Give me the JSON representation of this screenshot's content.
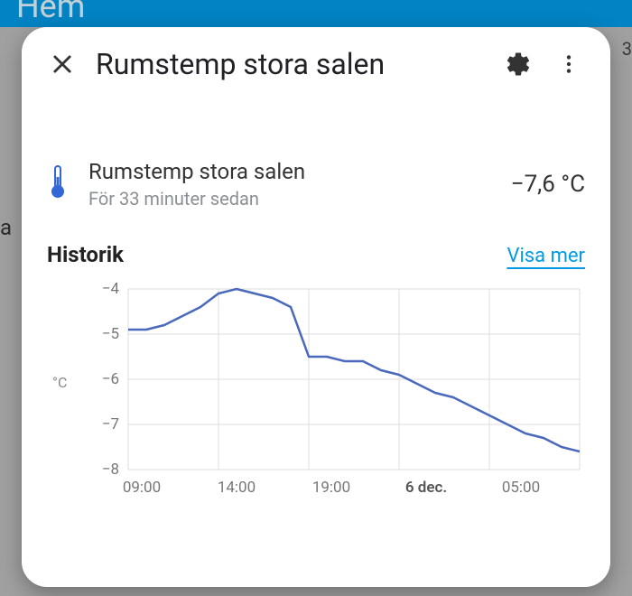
{
  "background": {
    "app_title": "Hem",
    "right_digit": "3",
    "left_fragment": "a"
  },
  "dialog": {
    "title": "Rumstemp stora salen"
  },
  "sensor": {
    "name": "Rumstemp stora salen",
    "updated": "För 33 minuter sedan",
    "value": "−7,6 °C"
  },
  "history": {
    "title": "Historik",
    "show_more": "Visa mer"
  },
  "chart_data": {
    "type": "line",
    "title": "",
    "xlabel": "",
    "ylabel": "°C",
    "ylim": [
      -8,
      -4
    ],
    "y_ticks": [
      -4,
      -5,
      -6,
      -7,
      -8
    ],
    "x_ticks": [
      "09:00",
      "14:00",
      "19:00",
      "6 dec.",
      "05:00"
    ],
    "x_tick_bold_index": 3,
    "x": [
      "08:00",
      "09:00",
      "10:00",
      "11:00",
      "12:00",
      "13:00",
      "14:00",
      "15:00",
      "16:00",
      "17:00",
      "17:30",
      "18:00",
      "19:00",
      "20:00",
      "21:00",
      "22:00",
      "23:00",
      "00:00",
      "01:00",
      "02:00",
      "03:00",
      "04:00",
      "05:00",
      "06:00",
      "07:00",
      "08:00"
    ],
    "values": [
      -4.9,
      -4.9,
      -4.8,
      -4.6,
      -4.4,
      -4.1,
      -4.0,
      -4.1,
      -4.2,
      -4.4,
      -5.5,
      -5.5,
      -5.6,
      -5.6,
      -5.8,
      -5.9,
      -6.1,
      -6.3,
      -6.4,
      -6.6,
      -6.8,
      -7.0,
      -7.2,
      -7.3,
      -7.5,
      -7.6
    ],
    "color": "#4a69bd"
  }
}
